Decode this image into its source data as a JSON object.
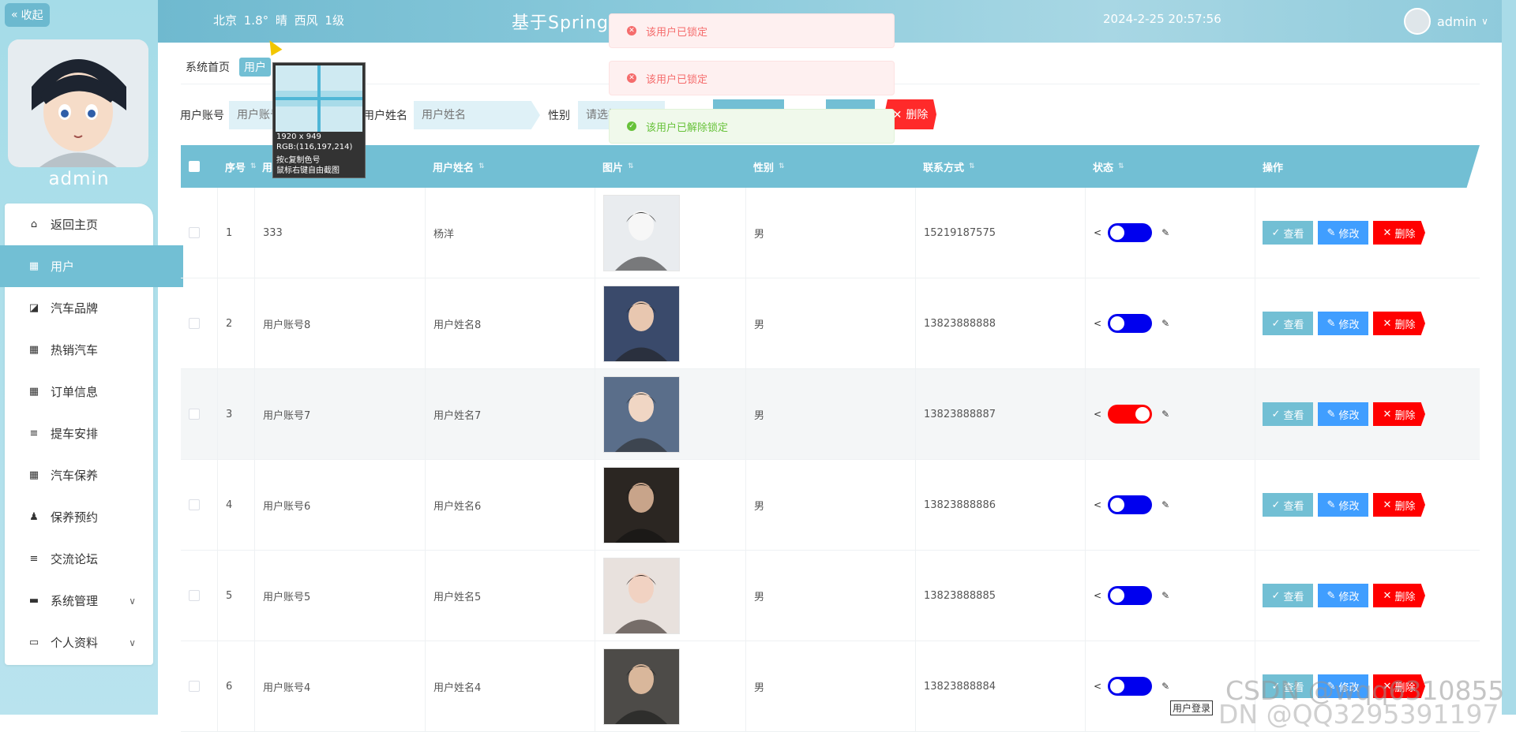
{
  "sidebar": {
    "collapse_label": "收起",
    "admin_name": "admin",
    "items": [
      {
        "label": "返回主页",
        "icon": "home-icon"
      },
      {
        "label": "用户",
        "icon": "grid-icon"
      },
      {
        "label": "汽车品牌",
        "icon": "chart-icon"
      },
      {
        "label": "热销汽车",
        "icon": "grid-icon"
      },
      {
        "label": "订单信息",
        "icon": "grid-icon"
      },
      {
        "label": "提车安排",
        "icon": "list-icon"
      },
      {
        "label": "汽车保养",
        "icon": "grid-icon"
      },
      {
        "label": "保养预约",
        "icon": "person-icon"
      },
      {
        "label": "交流论坛",
        "icon": "list-icon"
      },
      {
        "label": "系统管理",
        "icon": "monitor-icon"
      },
      {
        "label": "个人资料",
        "icon": "card-icon"
      }
    ]
  },
  "header": {
    "weather": "北京 1.8° 晴 西风 1级",
    "title": "基于Spring                                 与实现",
    "datetime": "2024-2-25 20:57:56",
    "username": "admin"
  },
  "breadcrumb": {
    "home": "系统首页",
    "current": "用户"
  },
  "search": {
    "account_label": "用户账号",
    "account_placeholder": "用户账号",
    "name_label": "用户姓名",
    "name_placeholder": "用户姓名",
    "gender_label": "性别",
    "gender_placeholder": "请选择",
    "delete_label": "删除"
  },
  "table": {
    "headers": [
      "序号",
      "用户账号",
      "用户姓名",
      "图片",
      "性别",
      "联系方式",
      "状态",
      "操作"
    ],
    "rows": [
      {
        "index": "1",
        "account": "333",
        "name": "杨洋",
        "gender": "男",
        "phone": "15219187575",
        "locked": false
      },
      {
        "index": "2",
        "account": "用户账号8",
        "name": "用户姓名8",
        "gender": "男",
        "phone": "13823888888",
        "locked": false
      },
      {
        "index": "3",
        "account": "用户账号7",
        "name": "用户姓名7",
        "gender": "男",
        "phone": "13823888887",
        "locked": true
      },
      {
        "index": "4",
        "account": "用户账号6",
        "name": "用户姓名6",
        "gender": "男",
        "phone": "13823888886",
        "locked": false
      },
      {
        "index": "5",
        "account": "用户账号5",
        "name": "用户姓名5",
        "gender": "男",
        "phone": "13823888885",
        "locked": false
      },
      {
        "index": "6",
        "account": "用户账号4",
        "name": "用户姓名4",
        "gender": "男",
        "phone": "13823888884",
        "locked": false
      }
    ],
    "view_label": "查看",
    "edit_label": "修改",
    "delete_label": "删除"
  },
  "toasts": [
    {
      "type": "error",
      "text": "该用户已锁定"
    },
    {
      "type": "error",
      "text": "该用户已锁定"
    },
    {
      "type": "success",
      "text": "该用户已解除锁定"
    }
  ],
  "picker": {
    "size": "1920 x 949",
    "rgb": "RGB:(116,197,214)",
    "hint1": "按c复制色号",
    "hint2": "鼠标右键自由截图"
  },
  "watermark": "CSDN @wqq6310855",
  "watermark2": "DN @QQ3295391197",
  "tooltip": "用户登录",
  "colors": {
    "accent": "#72bfd4",
    "toggle_on": "#0000ee",
    "toggle_locked": "#ff0000",
    "view_btn": "#72bfd4",
    "edit_btn": "#409eff",
    "delete_btn": "#ff0000"
  }
}
